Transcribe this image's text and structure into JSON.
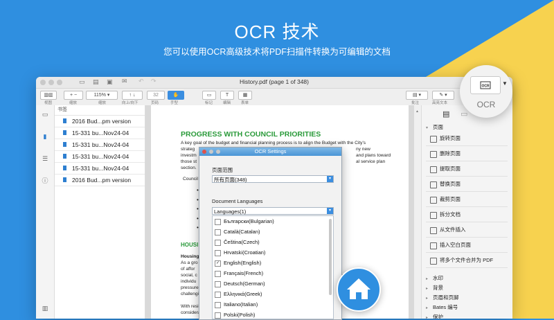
{
  "hero": {
    "title": "OCR 技术",
    "subtitle": "您可以使用OCR高级技术将PDF扫描件转换为可编辑的文档"
  },
  "colors": {
    "brand_blue": "#2f8fe0",
    "accent_yellow": "#f7d24f",
    "heading_green": "#2a9a3a"
  },
  "window": {
    "title": "History.pdf (page 1 of 348)"
  },
  "toolbar": {
    "labels": [
      "视图",
      "缩放",
      "缩放",
      "向上/向下",
      "页码",
      "手型",
      "标记",
      "编辑",
      "表单",
      "批注",
      "高亮文本"
    ],
    "zoom_value": "115%",
    "page_value": "32",
    "ocr_label": "OCR"
  },
  "bookmarks": {
    "header": "书签",
    "items": [
      "2016 Bud...pm version",
      "15-331 bu...Nov24-04",
      "15-331 bu...Nov24-04",
      "15-331 bu...Nov24-04",
      "15-331 bu...Nov24-04",
      "2016 Bud...pm version"
    ]
  },
  "document": {
    "heading": "PROGRESS WITH COUNCIL PRIORITIES",
    "para1": [
      "A key goal of the budget and financial planning process is to align the Budget with the City's",
      "strateg",
      "investm",
      "those st",
      "section."
    ],
    "para1_right": [
      "ny new",
      "and plans toward",
      "al service plan"
    ],
    "council": "Council",
    "heading2": "HOUSI",
    "housing": [
      "Housing",
      "As a gro",
      "of affor",
      "social, c",
      "individu",
      "pressures, bot",
      "challenging th"
    ],
    "footer": [
      "With resident",
      "considerably f"
    ]
  },
  "dialog": {
    "title": "OCR Settings",
    "page_range_label": "页面范围",
    "page_range_value": "所有页面(348)",
    "doc_lang_label": "Document Languages",
    "doc_lang_value": "Languages(1)",
    "languages": [
      {
        "name": "Български(Bulgarian)",
        "checked": false
      },
      {
        "name": "Català(Catalan)",
        "checked": false
      },
      {
        "name": "Čeština(Czech)",
        "checked": false
      },
      {
        "name": "Hrvatski(Croatian)",
        "checked": false
      },
      {
        "name": "English(English)",
        "checked": true
      },
      {
        "name": "Français(French)",
        "checked": false
      },
      {
        "name": "Deutsch(German)",
        "checked": false
      },
      {
        "name": "Ελληνικά(Greek)",
        "checked": false
      },
      {
        "name": "Italiano(Italian)",
        "checked": false
      },
      {
        "name": "Polski(Polish)",
        "checked": false
      }
    ]
  },
  "right_panel": {
    "section_page": "页面",
    "items": [
      "旋转页面",
      "删除页面",
      "提取页面",
      "替换页面",
      "裁剪页面",
      "拆分文档",
      "从文件插入",
      "插入空白页面",
      "将多个文件合并为 PDF"
    ],
    "sections": [
      "水印",
      "背景",
      "页眉和页脚",
      "Bates 编号",
      "保护"
    ]
  }
}
